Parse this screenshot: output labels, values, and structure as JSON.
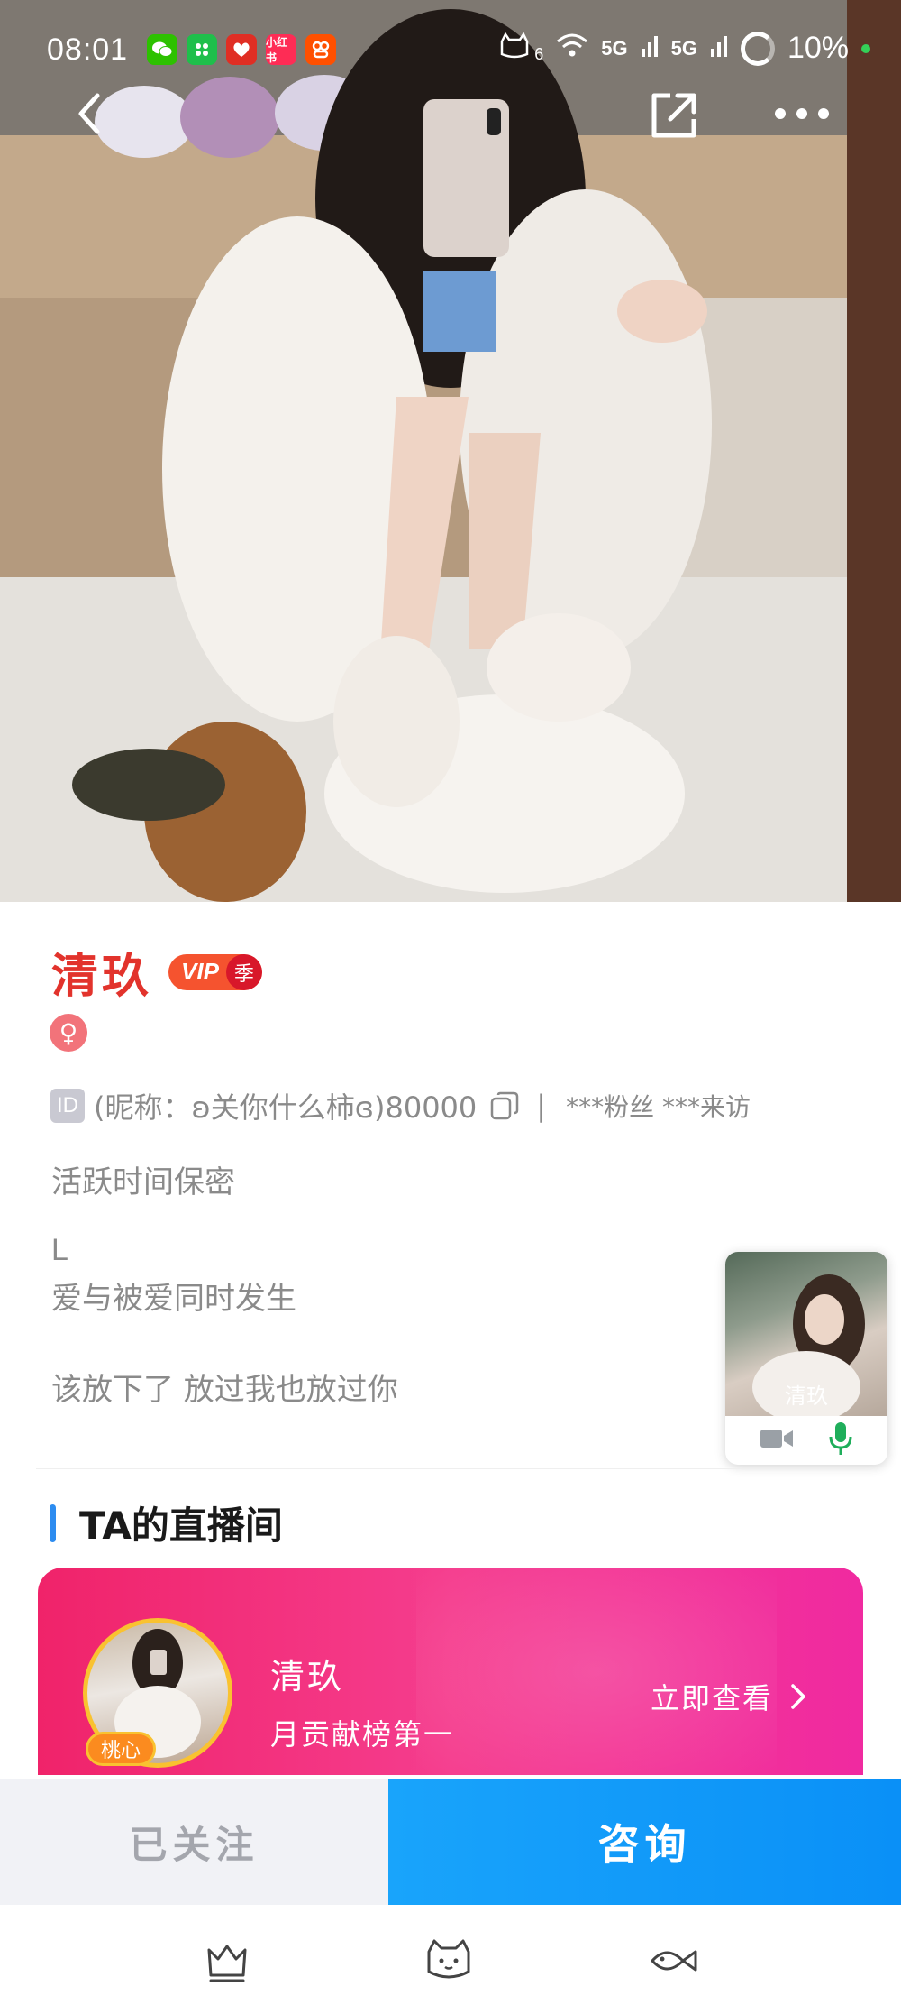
{
  "status_bar": {
    "time": "08:01",
    "app_icons": [
      {
        "name": "wechat-icon",
        "color": "#2dc100",
        "glyph": ""
      },
      {
        "name": "wechat-mini-icon",
        "color": "#1fbf4b",
        "glyph": ""
      },
      {
        "name": "pinduoduo-icon",
        "color": "#e02e24",
        "glyph": ""
      },
      {
        "name": "xiaohongshu-icon",
        "color": "#fe2c55",
        "glyph": "小红书"
      },
      {
        "name": "taobao-icon",
        "color": "#ff5000",
        "glyph": ""
      }
    ],
    "signal_1": "5G",
    "signal_2": "5G",
    "sim_count": "6",
    "battery": "10%"
  },
  "nav": {
    "back_icon": "chevron-left-icon",
    "share_icon": "share-icon",
    "more_icon": "more-horizontal-icon"
  },
  "profile": {
    "name": "清玖",
    "vip_label": "VIP",
    "vip_season": "季",
    "gender_symbol": "♀",
    "id_tag": "ID",
    "id_text": "(昵称：ʚ关你什么柿ɞ)80000",
    "separator": "|",
    "stats_text": "***粉丝 ***来访",
    "active_status": "活跃时间保密",
    "bio_line1": "L",
    "bio_line2": "爱与被爱同时发生",
    "bio_line3": "该放下了 放过我也放过你"
  },
  "float_window": {
    "name": "清玖",
    "video_icon": "video-camera-icon",
    "mic_icon": "microphone-icon",
    "mic_color": "#1fae5b"
  },
  "live_section": {
    "title": "TA的直播间",
    "accent": "#2d8cf0",
    "card": {
      "name": "清玖",
      "subtitle": "月贡献榜第一",
      "avatar_tag": "桃心",
      "view_label": "立即查看"
    }
  },
  "actions": {
    "followed_label": "已关注",
    "consult_label": "咨询",
    "consult_color": "#0a90f7"
  },
  "bottom_nav": [
    {
      "name": "crown-icon"
    },
    {
      "name": "cat-icon"
    },
    {
      "name": "fish-icon"
    }
  ]
}
